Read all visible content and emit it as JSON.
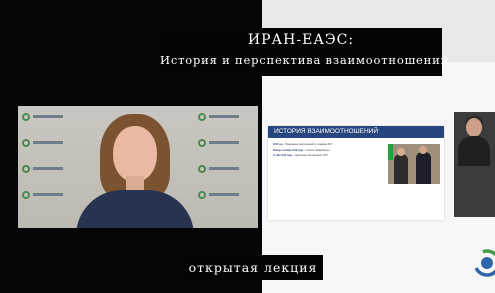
{
  "title": {
    "main": "ИРАН-ЕАЭС:",
    "sub": "История и перспектива взаимоотношений"
  },
  "slide": {
    "heading": "ИСТОРИЯ ВЗАИМООТНОШЕНИЙ",
    "bullets": [
      {
        "lead": "2015 год",
        "text": " – Проведение консультаций по созданию ЗСТ"
      },
      {
        "lead": "Январь-октябрь 2018 года",
        "text": " – отмечен товарооборот"
      },
      {
        "lead": "17 мая 2018 года",
        "text": " – подписание Соглашения о ЗСТ"
      }
    ]
  },
  "caption": "открытая лекция",
  "colors": {
    "slide_header": "#28467e",
    "logo_green": "#3f9b45",
    "logo_blue": "#2f66a8"
  }
}
